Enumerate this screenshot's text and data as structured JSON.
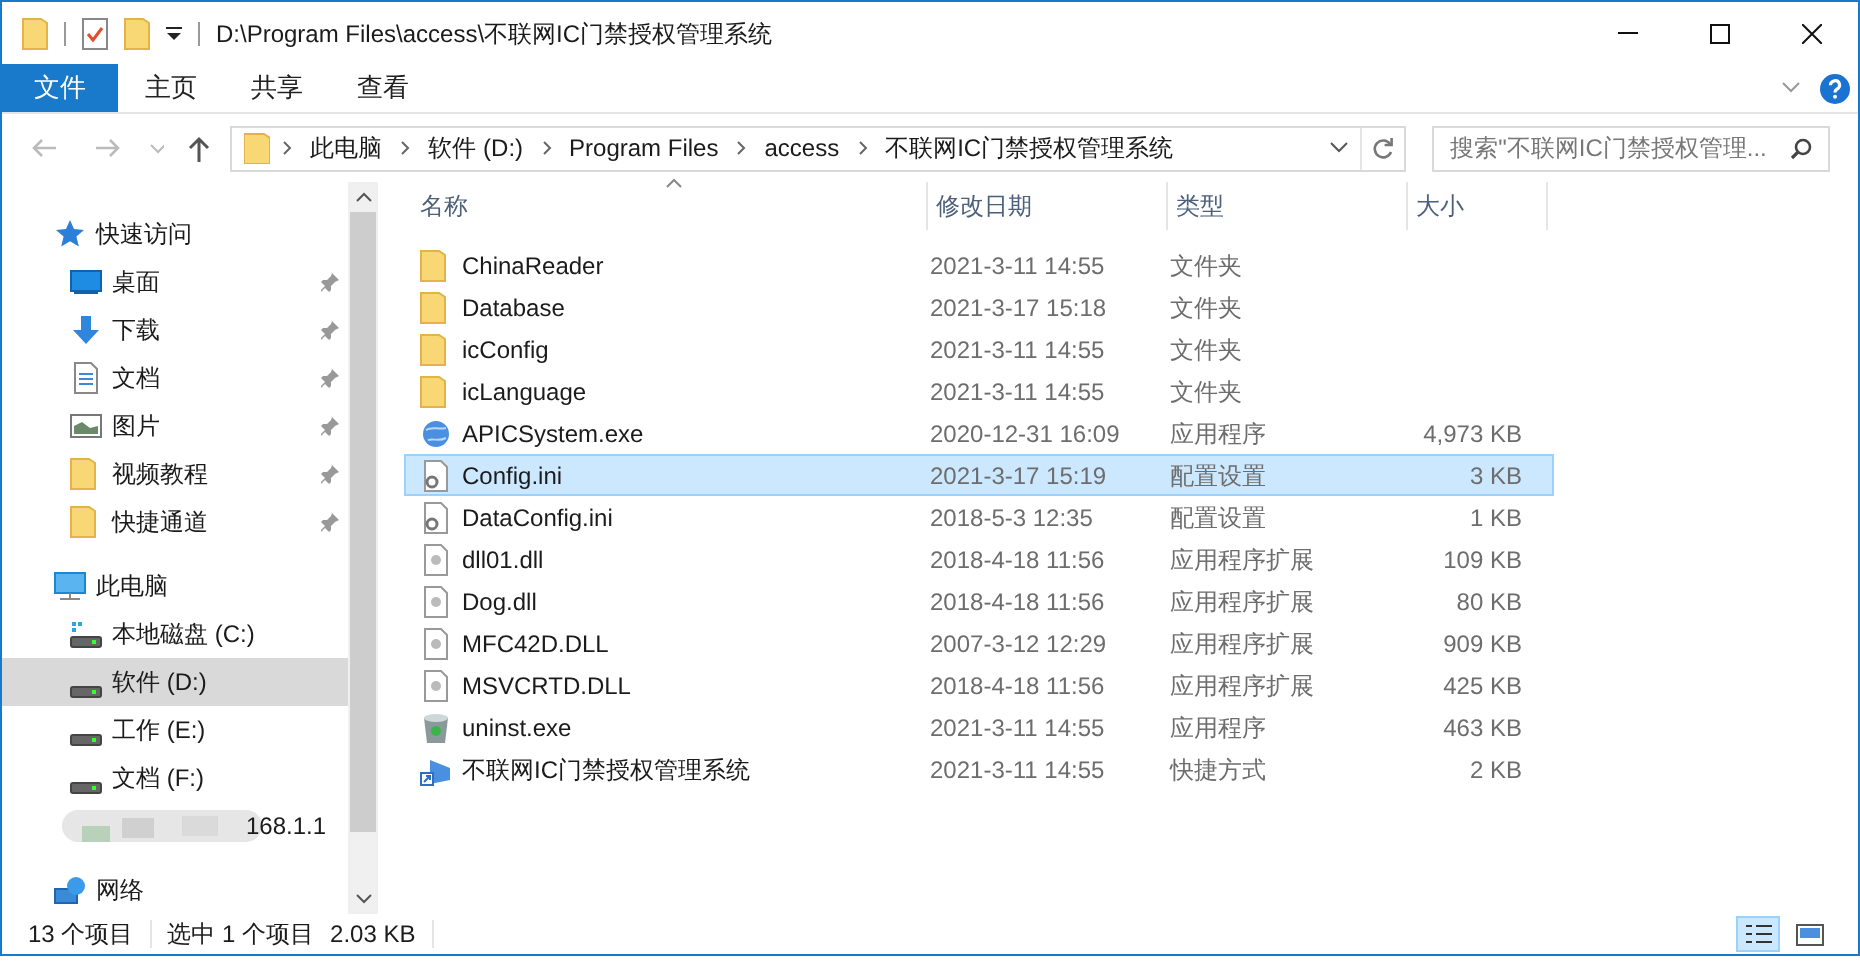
{
  "window": {
    "title": "D:\\Program Files\\access\\不联网IC门禁授权管理系统"
  },
  "ribbon_tabs": [
    {
      "label": "文件",
      "selected": true
    },
    {
      "label": "主页",
      "selected": false
    },
    {
      "label": "共享",
      "selected": false
    },
    {
      "label": "查看",
      "selected": false
    }
  ],
  "address_bar": {
    "crumbs": [
      "此电脑",
      "软件 (D:)",
      "Program Files",
      "access",
      "不联网IC门禁授权管理系统"
    ]
  },
  "search": {
    "placeholder": "搜索\"不联网IC门禁授权管理..."
  },
  "sidebar": {
    "items": [
      {
        "kind": "quick",
        "label": "快速访问",
        "pinned": false,
        "selected": false,
        "children": [
          {
            "kind": "desktop",
            "label": "桌面",
            "pinned": true,
            "selected": false
          },
          {
            "kind": "download",
            "label": "下载",
            "pinned": true,
            "selected": false
          },
          {
            "kind": "document",
            "label": "文档",
            "pinned": true,
            "selected": false
          },
          {
            "kind": "picture",
            "label": "图片",
            "pinned": true,
            "selected": false
          },
          {
            "kind": "folder",
            "label": "视频教程",
            "pinned": true,
            "selected": false
          },
          {
            "kind": "folder",
            "label": "快捷通道",
            "pinned": true,
            "selected": false
          }
        ]
      },
      {
        "kind": "pc",
        "label": "此电脑",
        "pinned": false,
        "selected": false,
        "children": [
          {
            "kind": "system-drive",
            "label": "本地磁盘 (C:)",
            "pinned": false,
            "selected": false
          },
          {
            "kind": "drive",
            "label": "软件 (D:)",
            "pinned": false,
            "selected": true
          },
          {
            "kind": "drive",
            "label": "工作 (E:)",
            "pinned": false,
            "selected": false
          },
          {
            "kind": "drive",
            "label": "文档 (F:)",
            "pinned": false,
            "selected": false
          },
          {
            "kind": "blurred",
            "label": "168.1.1",
            "pinned": false,
            "selected": false
          }
        ]
      },
      {
        "kind": "network",
        "label": "网络",
        "pinned": false,
        "selected": false
      }
    ]
  },
  "table": {
    "columns": [
      "名称",
      "修改日期",
      "类型",
      "大小"
    ],
    "rows": [
      {
        "kind": "folder",
        "name": "ChinaReader",
        "date": "2021-3-11 14:55",
        "type": "文件夹",
        "selected": false
      },
      {
        "kind": "folder",
        "name": "Database",
        "date": "2021-3-17 15:18",
        "type": "文件夹",
        "selected": false
      },
      {
        "kind": "folder",
        "name": "icConfig",
        "date": "2021-3-11 14:55",
        "type": "文件夹",
        "selected": false
      },
      {
        "kind": "folder",
        "name": "icLanguage",
        "date": "2021-3-11 14:55",
        "type": "文件夹",
        "selected": false
      },
      {
        "kind": "exe",
        "name": "APICSystem.exe",
        "date": "2020-12-31 16:09",
        "type": "应用程序",
        "size": "4,973 KB",
        "selected": false
      },
      {
        "kind": "ini",
        "name": "Config.ini",
        "date": "2021-3-17 15:19",
        "type": "配置设置",
        "size": "3 KB",
        "selected": true
      },
      {
        "kind": "ini",
        "name": "DataConfig.ini",
        "date": "2018-5-3 12:35",
        "type": "配置设置",
        "size": "1 KB",
        "selected": false
      },
      {
        "kind": "dll",
        "name": "dll01.dll",
        "date": "2018-4-18 11:56",
        "type": "应用程序扩展",
        "size": "109 KB",
        "selected": false
      },
      {
        "kind": "dll",
        "name": "Dog.dll",
        "date": "2018-4-18 11:56",
        "type": "应用程序扩展",
        "size": "80 KB",
        "selected": false
      },
      {
        "kind": "dll",
        "name": "MFC42D.DLL",
        "date": "2007-3-12 12:29",
        "type": "应用程序扩展",
        "size": "909 KB",
        "selected": false
      },
      {
        "kind": "dll",
        "name": "MSVCRTD.DLL",
        "date": "2018-4-18 11:56",
        "type": "应用程序扩展",
        "size": "425 KB",
        "selected": false
      },
      {
        "kind": "uninstaller",
        "name": "uninst.exe",
        "date": "2021-3-11 14:55",
        "type": "应用程序",
        "size": "463 KB",
        "selected": false
      },
      {
        "kind": "shortcut",
        "name": "不联网IC门禁授权管理系统",
        "date": "2021-3-11 14:55",
        "type": "快捷方式",
        "size": "2 KB",
        "selected": false
      }
    ]
  },
  "status_bar": {
    "item_count": "13 个项目",
    "selection": "选中 1 个项目",
    "selection_size": "2.03 KB"
  },
  "view_buttons": [
    {
      "kind": "details",
      "selected": true
    },
    {
      "kind": "thumbnails",
      "selected": false
    }
  ]
}
